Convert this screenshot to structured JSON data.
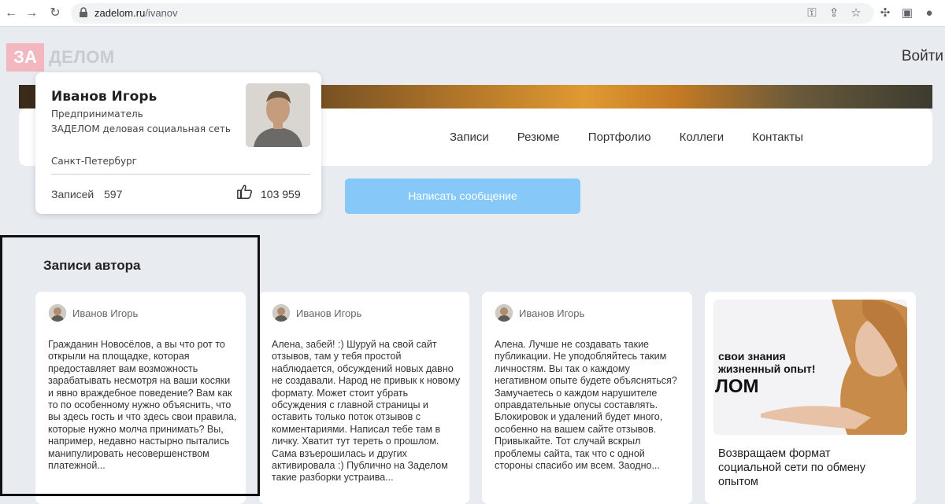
{
  "browser": {
    "url_domain": "zadelom.ru",
    "url_path": "/ivanov"
  },
  "site": {
    "logo_za": "ЗА",
    "logo_delom": "ДЕЛОМ",
    "login_label": "Войти"
  },
  "profile": {
    "name": "Иванов Игорь",
    "role": "Предприниматель",
    "org": "ЗАДЕЛОМ деловая социальная сеть",
    "city": "Санкт-Петербург",
    "posts_label": "Записей",
    "posts_count": "597",
    "likes_count": "103 959"
  },
  "nav": {
    "tabs": [
      "Записи",
      "Резюме",
      "Портфолио",
      "Коллеги",
      "Контакты"
    ]
  },
  "actions": {
    "message_button": "Написать сообщение"
  },
  "posts_section": {
    "title": "Записи автора",
    "posts": [
      {
        "author": "Иванов Игорь",
        "text": "Гражданин Новосёлов, а вы что рот то открыли на площадке, которая предоставляет вам возможность зарабатывать несмотря на ваши косяки и явно враждебное поведение? Вам как то по особенному нужно объяснить, что вы здесь гость и что здесь свои правила, которые нужно молча принимать? Вы, например, недавно настырно пытались манипулировать несовершенством платежной..."
      },
      {
        "author": "Иванов Игорь",
        "text": "Алена, забей! :) Шуруй на свой сайт отзывов, там у тебя простой наблюдается, обсуждений новых давно не создавали. Народ не привык к новому формату. Может стоит убрать обсуждения с главной страницы и оставить только поток отзывов с комментариями. Написал тебе там в личку. Хватит тут тереть о прошлом. Сама взъерошилась и других активировала :) Публично на Заделом такие разборки устраива..."
      },
      {
        "author": "Иванов Игорь",
        "text": "Алена. Лучше не создавать такие публикации. Не уподобляйтесь таким личностям. Вы так о каждому негативном опыте будете объясняться? Замучаетесь о каждом нарушителе оправдательные опусы составлять. Блокировок и удалений будет много, особенно на вашем сайте отзывов. Привыкайте. Тот случай вскрыл проблемы сайта, так что с одной стороны спасибо им всем. Заодно..."
      }
    ]
  },
  "ad": {
    "line1": "свои знания",
    "line2": "жизненный опыт!",
    "line3": "ЛОМ",
    "title": "Возвращаем формат социальной сети по обмену опытом"
  }
}
